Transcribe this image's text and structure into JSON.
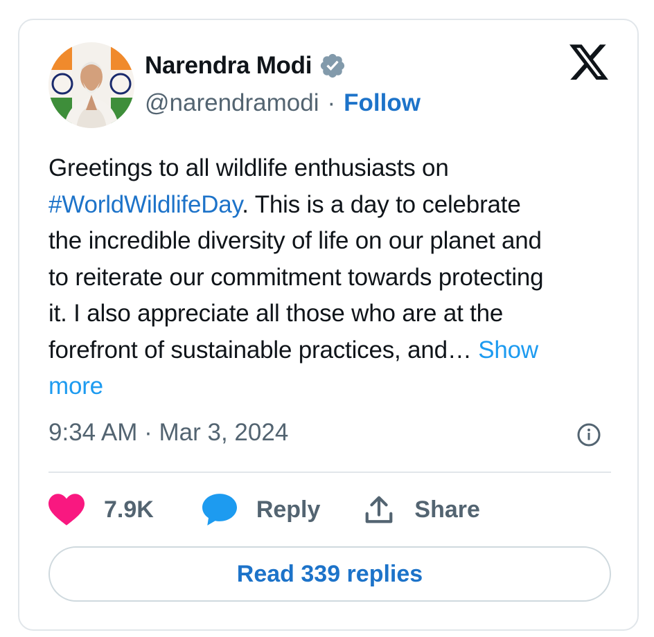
{
  "author": {
    "name": "Narendra Modi",
    "handle": "@narendramodi",
    "separator": "·",
    "follow_label": "Follow",
    "verified_icon": "verified-badge-icon",
    "verified_color": "#829aab"
  },
  "tweet": {
    "lines": [
      {
        "text": "Greetings to all wildlife enthusiasts on"
      },
      {
        "hashtag": "#WorldWildlifeDay",
        "text": ". This is a day to celebrate"
      },
      {
        "text": "the incredible diversity of life on our planet and"
      },
      {
        "text": "to reiterate our commitment towards protecting"
      },
      {
        "text": "it. I also appreciate all those who are at the"
      },
      {
        "text": "forefront of sustainable practices, and… ",
        "show_more": "Show"
      },
      {
        "show_more": "more"
      }
    ],
    "timestamp": "9:34 AM · Mar 3, 2024"
  },
  "actions": {
    "likes_count": "7.9K",
    "reply_label": "Reply",
    "share_label": "Share",
    "read_replies_label": "Read 339 replies"
  },
  "icons": {
    "platform_logo": "x-logo-icon",
    "info": "info-icon",
    "like": "heart-icon",
    "reply": "speech-bubble-icon",
    "share": "share-upload-icon"
  },
  "colors": {
    "link": "#1d73c9",
    "show_more": "#1d9bf0",
    "heart": "#f91880",
    "reply_bubble": "#1d9bf0",
    "secondary_text": "#536471",
    "border": "#e1e6ea"
  }
}
